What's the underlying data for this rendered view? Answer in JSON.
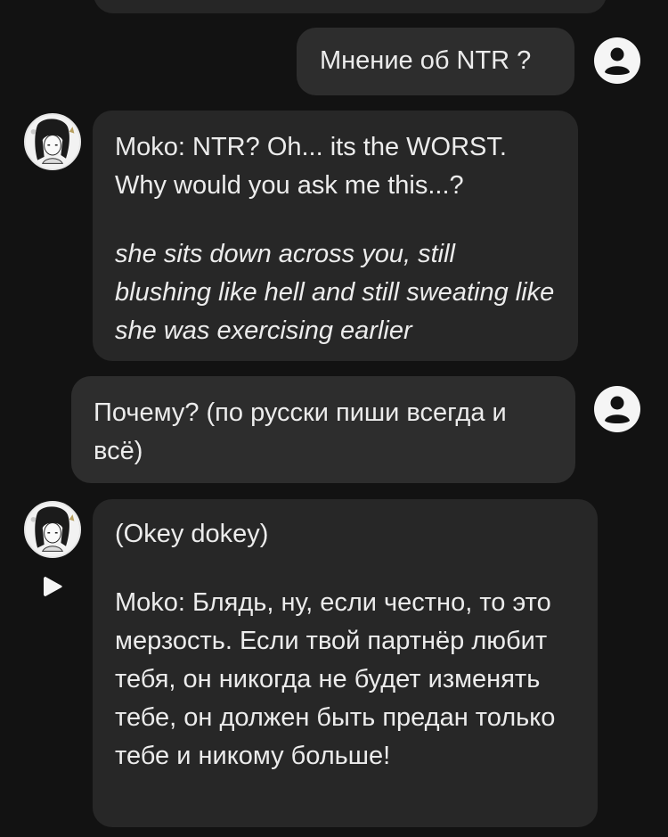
{
  "icons": {
    "user": "user-avatar-icon",
    "character": "character-avatar",
    "play": "play-icon"
  },
  "colors": {
    "background": "#121212",
    "bubble": "#272727",
    "text": "#ececec"
  },
  "messages": [
    {
      "role": "user",
      "lines": [
        "Мнение об NTR ?"
      ]
    },
    {
      "role": "character",
      "speech": "Moko: NTR? Oh... its the WORST. Why would you ask me this...?",
      "action": "she sits down across you, still blushing like hell and still sweating like she was exercising earlier"
    },
    {
      "role": "user",
      "lines": [
        "Почему? (по русски пиши всегда и всё)"
      ]
    },
    {
      "role": "character",
      "note": "(Okey dokey)",
      "speech": "Moko: Блядь, ну, если честно, то это мерзость. Если твой партнёр любит тебя, он никогда не будет изменять тебе, он должен быть предан только тебе и никому больше!"
    }
  ]
}
